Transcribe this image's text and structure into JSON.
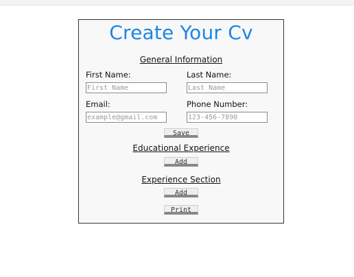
{
  "form": {
    "title": "Create Your Cv",
    "general_section": "General Information",
    "first_name_label": "First Name:",
    "first_name_placeholder": "First Name",
    "last_name_label": "Last Name:",
    "last_name_placeholder": "Last Name",
    "email_label": "Email:",
    "email_placeholder": "example@gmail.com",
    "phone_label": "Phone Number:",
    "phone_placeholder": "123-456-7890",
    "save_label": "Save",
    "education_section": "Educational Experience",
    "education_add_label": "Add",
    "experience_section": "Experience Section",
    "experience_add_label": "Add",
    "print_label": "Print"
  },
  "colors": {
    "title": "#1a86e8",
    "panel_background": "#f8f8f8",
    "button_shadow": "#888888"
  }
}
